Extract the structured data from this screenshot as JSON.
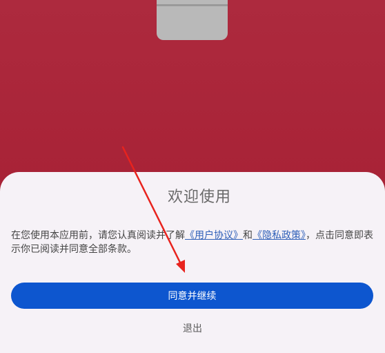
{
  "dialog": {
    "title": "欢迎使用",
    "body_prefix": "在您使用本应用前，请您认真阅读并了解",
    "user_agreement_link": "《用户协议》",
    "conjunction": "和",
    "privacy_policy_link": "《隐私政策》",
    "body_suffix": "，点击同意即表示你已阅读并同意全部条款。",
    "agree_button": "同意并继续",
    "exit_button": "退出"
  },
  "colors": {
    "background": "#a82438",
    "sheet": "#f6f2f7",
    "primary_button": "#0d56cf",
    "link": "#2e5fb8",
    "annotation_arrow": "#e8231e"
  },
  "icons": {
    "app_logo": "app-logo-placeholder"
  }
}
